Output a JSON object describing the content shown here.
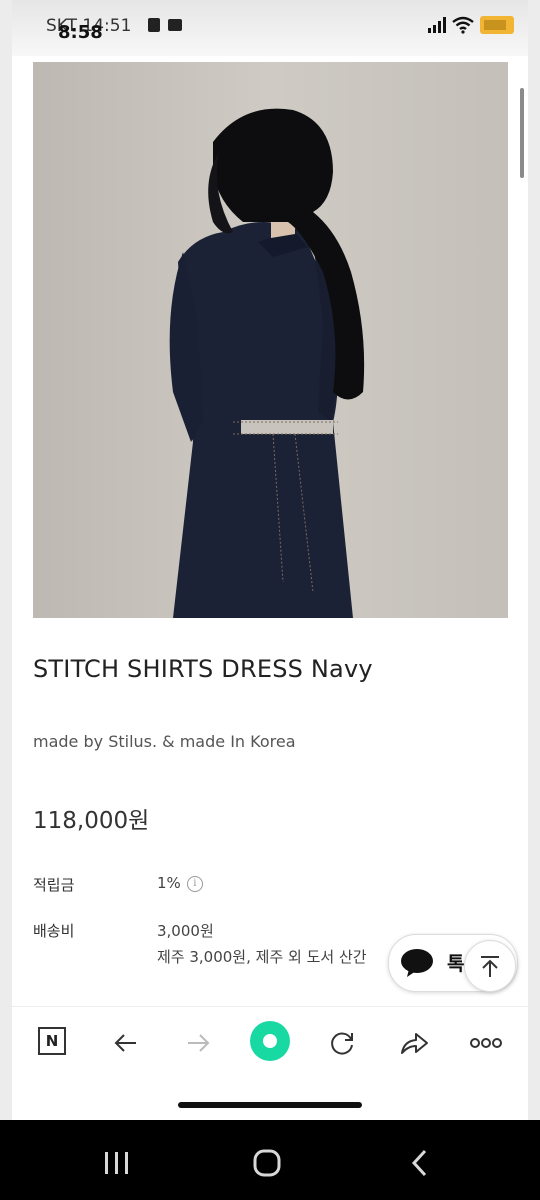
{
  "status_bar": {
    "carrier_time": "SKT 14:51",
    "time": "8:58"
  },
  "product": {
    "title": "STITCH SHIRTS DRESS Navy",
    "maker": "made by Stilus. & made In Korea",
    "price": "118,000원",
    "points_label": "적립금",
    "points_value": "1%",
    "shipping_label": "배송비",
    "shipping_value": "3,000원",
    "shipping_note": "제주 3,000원, 제주 외 도서 산간"
  },
  "floating": {
    "talk_label": "톡"
  },
  "browser_bar": {
    "home_label": "N",
    "icons": [
      "naver-home-icon",
      "back-arrow-icon",
      "forward-arrow-icon",
      "green-orb-icon",
      "refresh-icon",
      "share-icon",
      "more-icon"
    ]
  },
  "colors": {
    "accent_green": "#19d9a3",
    "dress_navy": "#1c2236",
    "photo_background": "#c6c2bb"
  }
}
